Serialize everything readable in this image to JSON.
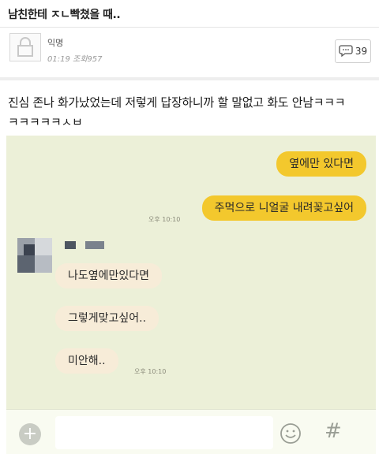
{
  "post": {
    "title": "남친한테 ㅈㄴ빡쳤을 때..",
    "author": "익명",
    "time": "01:19",
    "views_label": "조회",
    "views": "957",
    "comment_count": "39",
    "body_line1": "진심 존나 화가났었는데 저렇게 답장하니까 할 말없고 화도 안남ㅋㅋㅋ",
    "body_line2": "ㅋㅋㅋㅋㅋㅅㅂ"
  },
  "chat": {
    "outgoing": [
      "옆에만 있다면",
      "주먹으로 니얼굴 내려꽂고싶어"
    ],
    "outgoing_time": "오후 10:10",
    "incoming": [
      "나도옆에만있다면",
      "그렇게맞고싶어..",
      "미안해.."
    ],
    "incoming_time": "오후 10:10",
    "input_placeholder": ""
  },
  "colors": {
    "chat_bg": "#ecf0d8",
    "outgoing_bubble": "#f3c82d",
    "incoming_bubble": "#f7ecd8"
  },
  "icons": [
    "lock-icon",
    "comment-icon",
    "plus-icon",
    "emoji-icon",
    "hash-icon"
  ]
}
